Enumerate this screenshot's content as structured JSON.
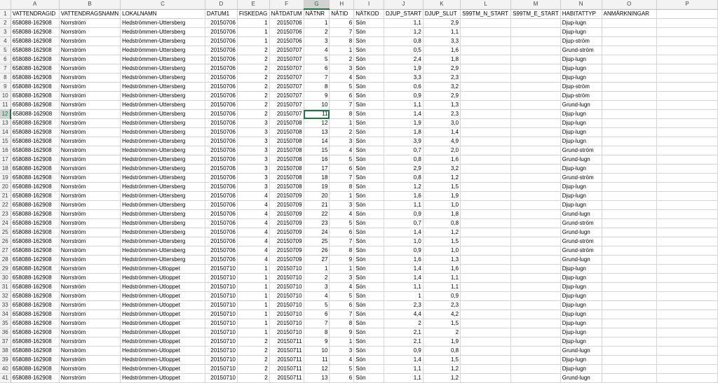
{
  "columns": [
    "A",
    "B",
    "C",
    "D",
    "E",
    "F",
    "G",
    "H",
    "I",
    "J",
    "K",
    "L",
    "M",
    "N",
    "O",
    "P"
  ],
  "active_column": "G",
  "active_row": "12",
  "selected_cell": {
    "row": 12,
    "col": 6
  },
  "numeric_columns": [
    3,
    4,
    5,
    6,
    7,
    9,
    10
  ],
  "rows": [
    {
      "n": "1",
      "c": [
        "VATTENDRAGID",
        "VATTENDRAGSNAMN",
        "LOKALNAMN",
        "DATUM1",
        "FISKEDAG",
        "NÄTDATUM",
        "NÄTNR",
        "NÄTID",
        "NÄTKOD",
        "DJUP_START",
        "DJUP_SLUT",
        "S99TM_N_START",
        "S99TM_E_START",
        "HABITATTYP",
        "ANMÄRKNINGAR",
        ""
      ]
    },
    {
      "n": "2",
      "c": [
        "658088-162908",
        "Norrström",
        "Hedströmmen-Uttersberg",
        "20150706",
        "1",
        "20150706",
        "1",
        "6",
        "Sön",
        "1,1",
        "2,9",
        "",
        "",
        "Djup-lugn",
        "",
        ""
      ]
    },
    {
      "n": "3",
      "c": [
        "658088-162908",
        "Norrström",
        "Hedströmmen-Uttersberg",
        "20150706",
        "1",
        "20150706",
        "2",
        "7",
        "Sön",
        "1,2",
        "1,1",
        "",
        "",
        "Djup-lugn",
        "",
        ""
      ]
    },
    {
      "n": "4",
      "c": [
        "658088-162908",
        "Norrström",
        "Hedströmmen-Uttersberg",
        "20150706",
        "1",
        "20150706",
        "3",
        "8",
        "Sön",
        "0,8",
        "3,3",
        "",
        "",
        "Djup-ström",
        "",
        ""
      ]
    },
    {
      "n": "5",
      "c": [
        "658088-162908",
        "Norrström",
        "Hedströmmen-Uttersberg",
        "20150706",
        "2",
        "20150707",
        "4",
        "1",
        "Sön",
        "0,5",
        "1,6",
        "",
        "",
        "Grund-ström",
        "",
        ""
      ]
    },
    {
      "n": "6",
      "c": [
        "658088-162908",
        "Norrström",
        "Hedströmmen-Uttersberg",
        "20150706",
        "2",
        "20150707",
        "5",
        "2",
        "Sön",
        "2,4",
        "1,8",
        "",
        "",
        "Djup-lugn",
        "",
        ""
      ]
    },
    {
      "n": "7",
      "c": [
        "658088-162908",
        "Norrström",
        "Hedströmmen-Uttersberg",
        "20150706",
        "2",
        "20150707",
        "6",
        "3",
        "Sön",
        "1,9",
        "2,9",
        "",
        "",
        "Djup-lugn",
        "",
        ""
      ]
    },
    {
      "n": "8",
      "c": [
        "658088-162908",
        "Norrström",
        "Hedströmmen-Uttersberg",
        "20150706",
        "2",
        "20150707",
        "7",
        "4",
        "Sön",
        "3,3",
        "2,3",
        "",
        "",
        "Djup-lugn",
        "",
        ""
      ]
    },
    {
      "n": "9",
      "c": [
        "658088-162908",
        "Norrström",
        "Hedströmmen-Uttersberg",
        "20150706",
        "2",
        "20150707",
        "8",
        "5",
        "Sön",
        "0,6",
        "3,2",
        "",
        "",
        "Djup-ström",
        "",
        ""
      ]
    },
    {
      "n": "10",
      "c": [
        "658088-162908",
        "Norrström",
        "Hedströmmen-Uttersberg",
        "20150706",
        "2",
        "20150707",
        "9",
        "6",
        "Sön",
        "0,9",
        "2,9",
        "",
        "",
        "Djup-ström",
        "",
        ""
      ]
    },
    {
      "n": "11",
      "c": [
        "658088-162908",
        "Norrström",
        "Hedströmmen-Uttersberg",
        "20150706",
        "2",
        "20150707",
        "10",
        "7",
        "Sön",
        "1,1",
        "1,3",
        "",
        "",
        "Grund-lugn",
        "",
        ""
      ]
    },
    {
      "n": "12",
      "c": [
        "658088-162908",
        "Norrström",
        "Hedströmmen-Uttersberg",
        "20150706",
        "2",
        "20150707",
        "11",
        "8",
        "Sön",
        "1,4",
        "2,3",
        "",
        "",
        "Djup-lugn",
        "",
        ""
      ]
    },
    {
      "n": "13",
      "c": [
        "658088-162908",
        "Norrström",
        "Hedströmmen-Uttersberg",
        "20150706",
        "3",
        "20150708",
        "12",
        "1",
        "Sön",
        "1,9",
        "3,0",
        "",
        "",
        "Djup-lugn",
        "",
        ""
      ]
    },
    {
      "n": "14",
      "c": [
        "658088-162908",
        "Norrström",
        "Hedströmmen-Uttersberg",
        "20150706",
        "3",
        "20150708",
        "13",
        "2",
        "Sön",
        "1,8",
        "1,4",
        "",
        "",
        "Djup-lugn",
        "",
        ""
      ]
    },
    {
      "n": "15",
      "c": [
        "658088-162908",
        "Norrström",
        "Hedströmmen-Uttersberg",
        "20150706",
        "3",
        "20150708",
        "14",
        "3",
        "Sön",
        "3,9",
        "4,9",
        "",
        "",
        "Djup-lugn",
        "",
        ""
      ]
    },
    {
      "n": "16",
      "c": [
        "658088-162908",
        "Norrström",
        "Hedströmmen-Uttersberg",
        "20150706",
        "3",
        "20150708",
        "15",
        "4",
        "Sön",
        "0,7",
        "2,0",
        "",
        "",
        "Grund-ström",
        "",
        ""
      ]
    },
    {
      "n": "17",
      "c": [
        "658088-162908",
        "Norrström",
        "Hedströmmen-Uttersberg",
        "20150706",
        "3",
        "20150708",
        "16",
        "5",
        "Sön",
        "0,8",
        "1,6",
        "",
        "",
        "Grund-lugn",
        "",
        ""
      ]
    },
    {
      "n": "18",
      "c": [
        "658088-162908",
        "Norrström",
        "Hedströmmen-Uttersberg",
        "20150706",
        "3",
        "20150708",
        "17",
        "6",
        "Sön",
        "2,9",
        "3,2",
        "",
        "",
        "Djup-lugn",
        "",
        ""
      ]
    },
    {
      "n": "19",
      "c": [
        "658088-162908",
        "Norrström",
        "Hedströmmen-Uttersberg",
        "20150706",
        "3",
        "20150708",
        "18",
        "7",
        "Sön",
        "0,8",
        "1,2",
        "",
        "",
        "Grund-ström",
        "",
        ""
      ]
    },
    {
      "n": "20",
      "c": [
        "658088-162908",
        "Norrström",
        "Hedströmmen-Uttersberg",
        "20150706",
        "3",
        "20150708",
        "19",
        "8",
        "Sön",
        "1,2",
        "1,5",
        "",
        "",
        "Djup-lugn",
        "",
        ""
      ]
    },
    {
      "n": "21",
      "c": [
        "658088-162908",
        "Norrström",
        "Hedströmmen-Uttersberg",
        "20150706",
        "4",
        "20150709",
        "20",
        "1",
        "Sön",
        "1,6",
        "1,9",
        "",
        "",
        "Djup-lugn",
        "",
        ""
      ]
    },
    {
      "n": "22",
      "c": [
        "658088-162908",
        "Norrström",
        "Hedströmmen-Uttersberg",
        "20150706",
        "4",
        "20150709",
        "21",
        "3",
        "Sön",
        "1,1",
        "1,0",
        "",
        "",
        "Djup-lugn",
        "",
        ""
      ]
    },
    {
      "n": "23",
      "c": [
        "658088-162908",
        "Norrström",
        "Hedströmmen-Uttersberg",
        "20150706",
        "4",
        "20150709",
        "22",
        "4",
        "Sön",
        "0,9",
        "1,8",
        "",
        "",
        "Grund-lugn",
        "",
        ""
      ]
    },
    {
      "n": "24",
      "c": [
        "658088-162908",
        "Norrström",
        "Hedströmmen-Uttersberg",
        "20150706",
        "4",
        "20150709",
        "23",
        "5",
        "Sön",
        "0,7",
        "0,8",
        "",
        "",
        "Grund-ström",
        "",
        ""
      ]
    },
    {
      "n": "25",
      "c": [
        "658088-162908",
        "Norrström",
        "Hedströmmen-Uttersberg",
        "20150706",
        "4",
        "20150709",
        "24",
        "6",
        "Sön",
        "1,4",
        "1,2",
        "",
        "",
        "Grund-lugn",
        "",
        ""
      ]
    },
    {
      "n": "26",
      "c": [
        "658088-162908",
        "Norrström",
        "Hedströmmen-Uttersberg",
        "20150706",
        "4",
        "20150709",
        "25",
        "7",
        "Sön",
        "1,0",
        "1,5",
        "",
        "",
        "Grund-ström",
        "",
        ""
      ]
    },
    {
      "n": "27",
      "c": [
        "658088-162908",
        "Norrström",
        "Hedströmmen-Uttersberg",
        "20150706",
        "4",
        "20150709",
        "26",
        "8",
        "Sön",
        "0,9",
        "1,0",
        "",
        "",
        "Grund-ström",
        "",
        ""
      ]
    },
    {
      "n": "28",
      "c": [
        "658088-162908",
        "Norrström",
        "Hedströmmen-Uttersberg",
        "20150706",
        "4",
        "20150709",
        "27",
        "9",
        "Sön",
        "1,6",
        "1,3",
        "",
        "",
        "Grund-lugn",
        "",
        ""
      ]
    },
    {
      "n": "29",
      "c": [
        "658088-162908",
        "Norrström",
        "Hedströmmen-Utloppet",
        "20150710",
        "1",
        "20150710",
        "1",
        "1",
        "Sön",
        "1,4",
        "1,6",
        "",
        "",
        "Djup-lugn",
        "",
        ""
      ]
    },
    {
      "n": "30",
      "c": [
        "658088-162908",
        "Norrström",
        "Hedströmmen-Utloppet",
        "20150710",
        "1",
        "20150710",
        "2",
        "3",
        "Sön",
        "1,4",
        "1,1",
        "",
        "",
        "Djup-lugn",
        "",
        ""
      ]
    },
    {
      "n": "31",
      "c": [
        "658088-162908",
        "Norrström",
        "Hedströmmen-Utloppet",
        "20150710",
        "1",
        "20150710",
        "3",
        "4",
        "Sön",
        "1,1",
        "1,1",
        "",
        "",
        "Djup-lugn",
        "",
        ""
      ]
    },
    {
      "n": "32",
      "c": [
        "658088-162908",
        "Norrström",
        "Hedströmmen-Utloppet",
        "20150710",
        "1",
        "20150710",
        "4",
        "5",
        "Sön",
        "1",
        "0,9",
        "",
        "",
        "Djup-lugn",
        "",
        ""
      ]
    },
    {
      "n": "33",
      "c": [
        "658088-162908",
        "Norrström",
        "Hedströmmen-Utloppet",
        "20150710",
        "1",
        "20150710",
        "5",
        "6",
        "Sön",
        "2,3",
        "2,3",
        "",
        "",
        "Djup-lugn",
        "",
        ""
      ]
    },
    {
      "n": "34",
      "c": [
        "658088-162908",
        "Norrström",
        "Hedströmmen-Utloppet",
        "20150710",
        "1",
        "20150710",
        "6",
        "7",
        "Sön",
        "4,4",
        "4,2",
        "",
        "",
        "Djup-lugn",
        "",
        ""
      ]
    },
    {
      "n": "35",
      "c": [
        "658088-162908",
        "Norrström",
        "Hedströmmen-Utloppet",
        "20150710",
        "1",
        "20150710",
        "7",
        "8",
        "Sön",
        "2",
        "1,5",
        "",
        "",
        "Djup-lugn",
        "",
        ""
      ]
    },
    {
      "n": "36",
      "c": [
        "658088-162908",
        "Norrström",
        "Hedströmmen-Utloppet",
        "20150710",
        "1",
        "20150710",
        "8",
        "9",
        "Sön",
        "2,1",
        "2",
        "",
        "",
        "Djup-lugn",
        "",
        ""
      ]
    },
    {
      "n": "37",
      "c": [
        "658088-162908",
        "Norrström",
        "Hedströmmen-Utloppet",
        "20150710",
        "2",
        "20150711",
        "9",
        "1",
        "Sön",
        "2,1",
        "1,9",
        "",
        "",
        "Djup-lugn",
        "",
        ""
      ]
    },
    {
      "n": "38",
      "c": [
        "658088-162908",
        "Norrström",
        "Hedströmmen-Utloppet",
        "20150710",
        "2",
        "20150711",
        "10",
        "3",
        "Sön",
        "0,9",
        "0,8",
        "",
        "",
        "Grund-lugn",
        "",
        ""
      ]
    },
    {
      "n": "39",
      "c": [
        "658088-162908",
        "Norrström",
        "Hedströmmen-Utloppet",
        "20150710",
        "2",
        "20150711",
        "11",
        "4",
        "Sön",
        "1,4",
        "1,5",
        "",
        "",
        "Djup-lugn",
        "",
        ""
      ]
    },
    {
      "n": "40",
      "c": [
        "658088-162908",
        "Norrström",
        "Hedströmmen-Utloppet",
        "20150710",
        "2",
        "20150711",
        "12",
        "5",
        "Sön",
        "1,1",
        "1,2",
        "",
        "",
        "Djup-lugn",
        "",
        ""
      ]
    },
    {
      "n": "41",
      "c": [
        "658088-162908",
        "Norrström",
        "Hedströmmen-Utloppet",
        "20150710",
        "2",
        "20150711",
        "13",
        "6",
        "Sön",
        "1,1",
        "1,2",
        "",
        "",
        "Grund-lugn",
        "",
        ""
      ]
    }
  ]
}
